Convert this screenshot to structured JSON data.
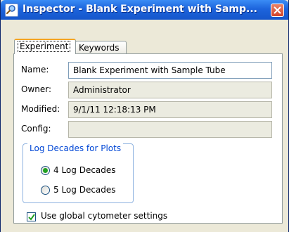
{
  "window": {
    "title": "Inspector - Blank Experiment with Samp...",
    "icon": "search-magnifier-icon",
    "close_icon": "close-icon"
  },
  "tabs": [
    {
      "label": "Experiment",
      "selected": true
    },
    {
      "label": "Keywords",
      "selected": false
    }
  ],
  "form": {
    "name_label": "Name:",
    "name_value": "Blank Experiment with Sample Tube",
    "owner_label": "Owner:",
    "owner_value": "Administrator",
    "modified_label": "Modified:",
    "modified_value": "9/1/11 12:18:13 PM",
    "config_label": "Config:",
    "config_value": ""
  },
  "log_decades": {
    "group_title": "Log Decades for Plots",
    "options": [
      {
        "label": "4 Log Decades",
        "selected": true
      },
      {
        "label": "5 Log Decades",
        "selected": false
      }
    ]
  },
  "global_settings": {
    "label": "Use global cytometer settings",
    "checked": true
  }
}
